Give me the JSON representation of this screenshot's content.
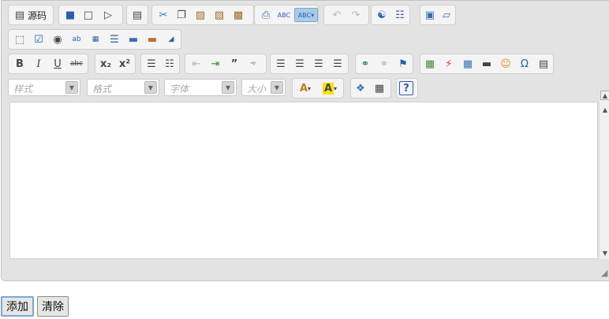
{
  "toolbar": {
    "source_label": "源码",
    "combos": {
      "style": "样式",
      "format": "格式",
      "font": "字体",
      "size": "大小"
    },
    "icons": {
      "bold": "B",
      "italic": "I",
      "underline": "U",
      "strike": "abc",
      "subscript": "x₂",
      "superscript": "x²",
      "omega": "Ω",
      "help": "?",
      "abc_spell": "ABC"
    }
  },
  "form": {
    "add_button": "添加",
    "clear_button": "清除"
  },
  "colors": {
    "toolbar_bg": "#e3e3e3",
    "group_bg": "#f4f4f4",
    "active_button": "#a7cbe8"
  }
}
